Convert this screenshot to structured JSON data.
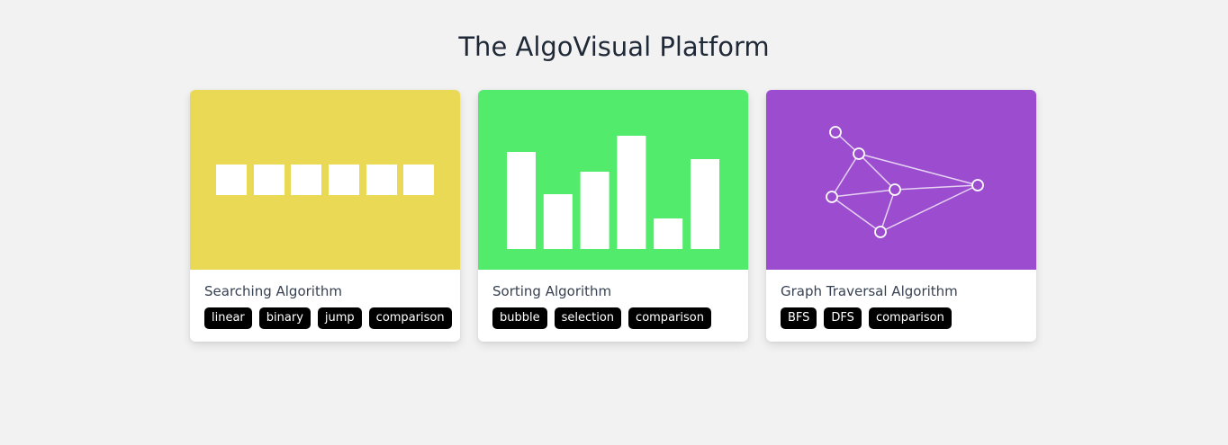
{
  "page": {
    "title": "The AlgoVisual Platform",
    "background": "#f2f2f2"
  },
  "cards": [
    {
      "title": "Searching Algorithm",
      "color": "#e9d954",
      "illustration": "array-boxes",
      "tags": [
        "linear",
        "binary",
        "jump",
        "comparison"
      ]
    },
    {
      "title": "Sorting Algorithm",
      "color": "#52eb6c",
      "illustration": "bar-graph",
      "bar_values": [
        108,
        61,
        86,
        126,
        34,
        100
      ],
      "tags": [
        "bubble",
        "selection",
        "comparison"
      ]
    },
    {
      "title": "Graph Traversal Algorithm",
      "color": "#9b4ccf",
      "illustration": "node-graph",
      "tags": [
        "BFS",
        "DFS",
        "comparison"
      ]
    }
  ]
}
